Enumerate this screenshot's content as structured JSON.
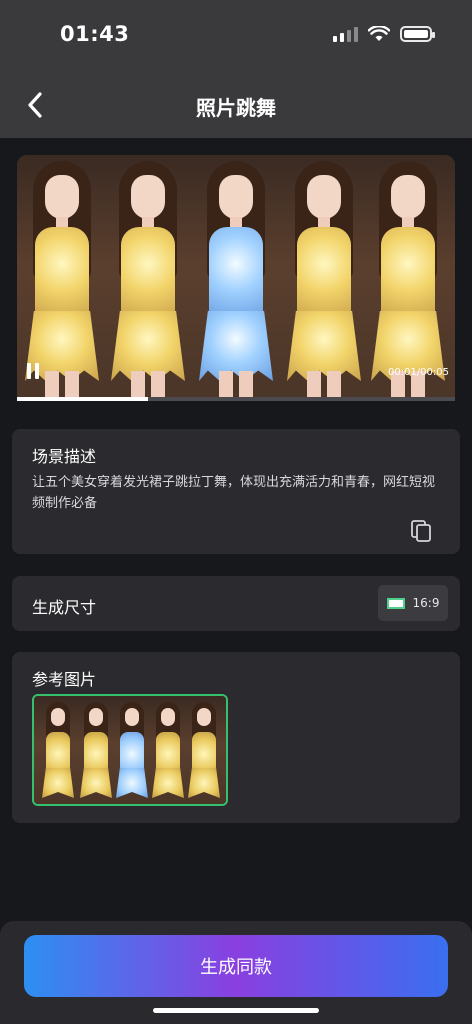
{
  "status_bar": {
    "time": "01:43"
  },
  "header": {
    "title": "照片跳舞"
  },
  "video": {
    "time_display": "00:01/00:05",
    "progress_fraction": 0.3
  },
  "description": {
    "label": "场景描述",
    "text": "让五个美女穿着发光裙子跳拉丁舞，体现出充满活力和青春，网红短视频制作必备"
  },
  "size": {
    "label": "生成尺寸",
    "ratio": "16:9"
  },
  "reference": {
    "label": "参考图片"
  },
  "action": {
    "generate_label": "生成同款"
  },
  "colors": {
    "background": "#17181c",
    "card": "#2b2b2f",
    "accent_green": "#36c06e",
    "button_gradient": [
      "#2d8ff2",
      "#8a3fe0",
      "#3a6ff0"
    ]
  },
  "icons": [
    "back-chevron-icon",
    "cellular-signal-icon",
    "wifi-icon",
    "battery-icon",
    "pause-icon",
    "copy-icon",
    "aspect-ratio-icon"
  ]
}
